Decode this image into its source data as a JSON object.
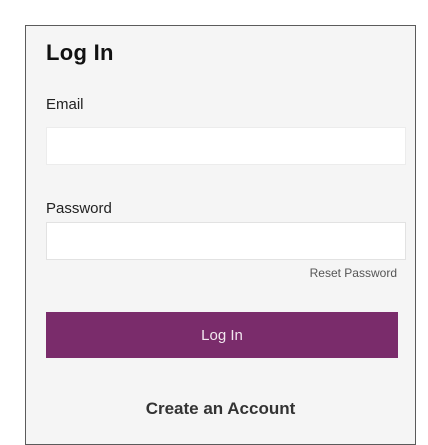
{
  "login_form": {
    "title": "Log In",
    "email_label": "Email",
    "email_value": "",
    "password_label": "Password",
    "password_value": "",
    "reset_password_label": "Reset Password",
    "submit_label": "Log In",
    "create_account_label": "Create an Account"
  },
  "colors": {
    "accent": "#7a2c6b",
    "panel_background": "#f5f5f5",
    "panel_border": "#5b5b5b"
  }
}
